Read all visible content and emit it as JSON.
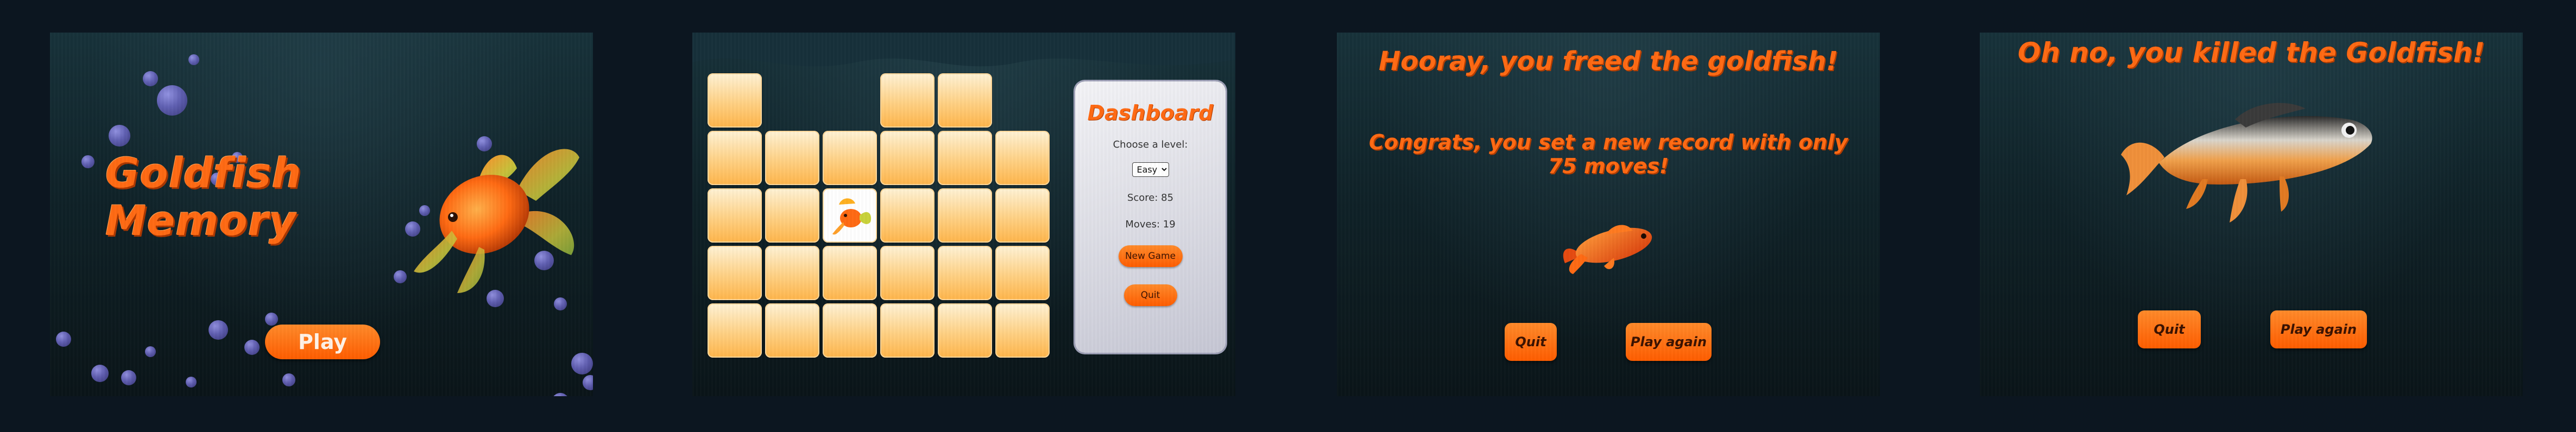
{
  "start_screen": {
    "title_line1": "Goldfish",
    "title_line2": "Memory",
    "play_label": "Play"
  },
  "game_screen": {
    "dashboard": {
      "title": "Dashboard",
      "level_label": "Choose a level:",
      "level_selected": "Easy",
      "score_text": "Score: 85",
      "moves_text": "Moves: 19",
      "new_game_label": "New Game",
      "quit_label": "Quit"
    }
  },
  "win_screen": {
    "headline": "Hooray, you freed the goldfish!",
    "record_line1": "Congrats, you set a new record with only",
    "record_line2": "75 moves!",
    "quit_label": "Quit",
    "play_again_label": "Play again"
  },
  "lose_screen": {
    "headline": "Oh no, you killed the Goldfish!",
    "quit_label": "Quit",
    "play_again_label": "Play again"
  },
  "colors": {
    "accent": "#ff6a13",
    "card": "#ffcf80",
    "background": "#0c1620"
  }
}
